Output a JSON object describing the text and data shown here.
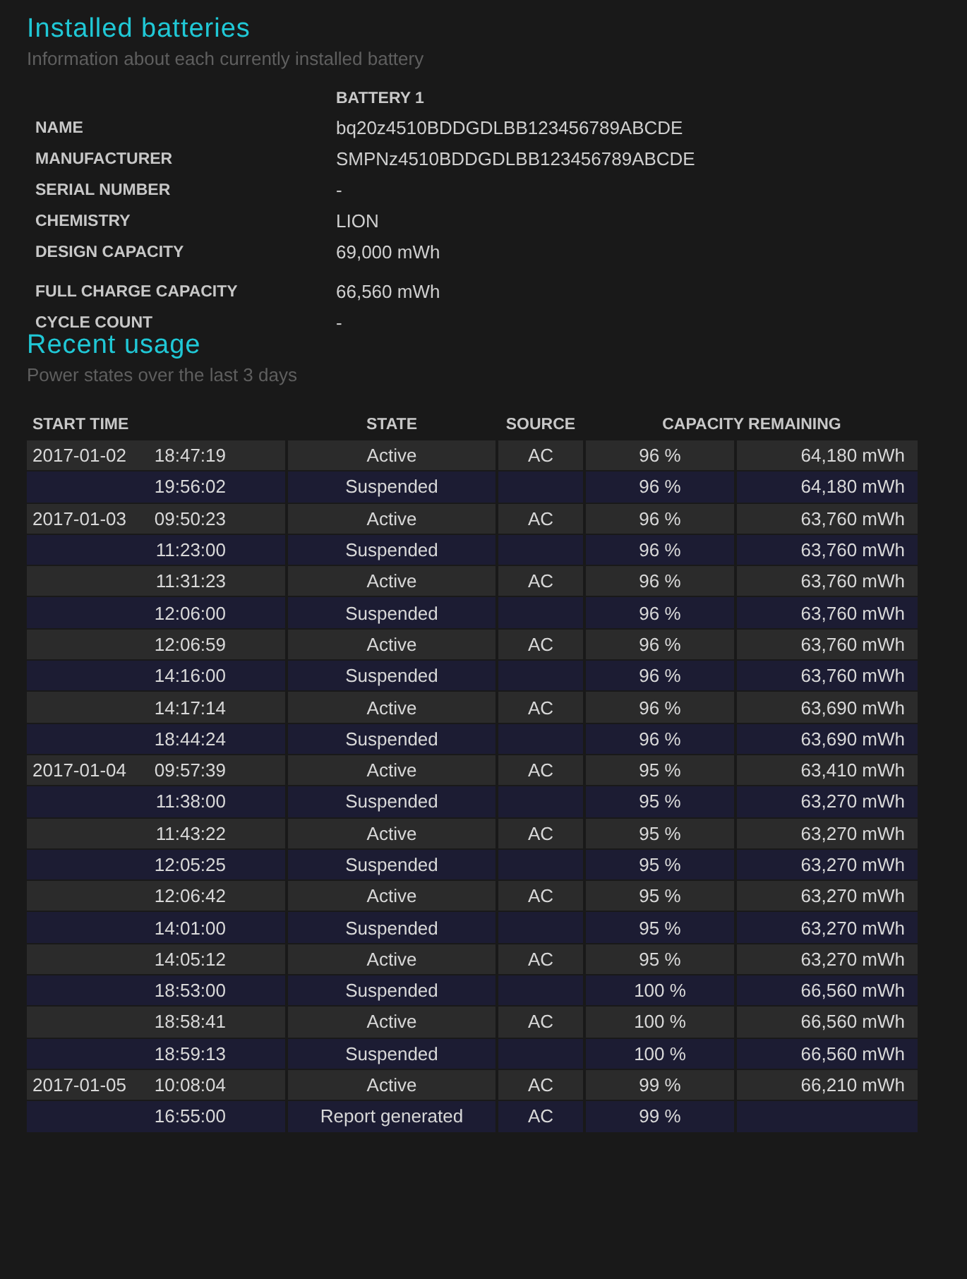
{
  "installed": {
    "title": "Installed batteries",
    "subtitle": "Information about each currently installed battery",
    "column": "BATTERY 1",
    "fields": [
      {
        "label": "NAME",
        "value": "bq20z4510BDDGDLBB123456789ABCDE"
      },
      {
        "label": "MANUFACTURER",
        "value": "SMPNz4510BDDGDLBB123456789ABCDE"
      },
      {
        "label": "SERIAL NUMBER",
        "value": "-"
      },
      {
        "label": "CHEMISTRY",
        "value": "LION"
      },
      {
        "label": "DESIGN CAPACITY",
        "value": "69,000 mWh"
      },
      {
        "label": "FULL CHARGE CAPACITY",
        "value": "66,560 mWh"
      },
      {
        "label": "CYCLE COUNT",
        "value": "-"
      }
    ]
  },
  "recent": {
    "title": "Recent usage",
    "subtitle": "Power states over the last 3 days",
    "columns": [
      "START TIME",
      "STATE",
      "SOURCE",
      "CAPACITY REMAINING"
    ],
    "rows": [
      {
        "date": "2017-01-02",
        "time": "18:47:19",
        "state": "Active",
        "source": "AC",
        "percent": "96 %",
        "capacity": "64,180 mWh"
      },
      {
        "time": "19:56:02",
        "state": "Suspended",
        "percent": "96 %",
        "capacity": "64,180 mWh"
      },
      {
        "date": "2017-01-03",
        "time": "09:50:23",
        "state": "Active",
        "source": "AC",
        "percent": "96 %",
        "capacity": "63,760 mWh"
      },
      {
        "time": "11:23:00",
        "state": "Suspended",
        "percent": "96 %",
        "capacity": "63,760 mWh"
      },
      {
        "time": "11:31:23",
        "state": "Active",
        "source": "AC",
        "percent": "96 %",
        "capacity": "63,760 mWh"
      },
      {
        "time": "12:06:00",
        "state": "Suspended",
        "percent": "96 %",
        "capacity": "63,760 mWh"
      },
      {
        "time": "12:06:59",
        "state": "Active",
        "source": "AC",
        "percent": "96 %",
        "capacity": "63,760 mWh"
      },
      {
        "time": "14:16:00",
        "state": "Suspended",
        "percent": "96 %",
        "capacity": "63,760 mWh"
      },
      {
        "time": "14:17:14",
        "state": "Active",
        "source": "AC",
        "percent": "96 %",
        "capacity": "63,690 mWh"
      },
      {
        "time": "18:44:24",
        "state": "Suspended",
        "percent": "96 %",
        "capacity": "63,690 mWh"
      },
      {
        "date": "2017-01-04",
        "time": "09:57:39",
        "state": "Active",
        "source": "AC",
        "percent": "95 %",
        "capacity": "63,410 mWh"
      },
      {
        "time": "11:38:00",
        "state": "Suspended",
        "percent": "95 %",
        "capacity": "63,270 mWh"
      },
      {
        "time": "11:43:22",
        "state": "Active",
        "source": "AC",
        "percent": "95 %",
        "capacity": "63,270 mWh"
      },
      {
        "time": "12:05:25",
        "state": "Suspended",
        "percent": "95 %",
        "capacity": "63,270 mWh"
      },
      {
        "time": "12:06:42",
        "state": "Active",
        "source": "AC",
        "percent": "95 %",
        "capacity": "63,270 mWh"
      },
      {
        "time": "14:01:00",
        "state": "Suspended",
        "percent": "95 %",
        "capacity": "63,270 mWh"
      },
      {
        "time": "14:05:12",
        "state": "Active",
        "source": "AC",
        "percent": "95 %",
        "capacity": "63,270 mWh"
      },
      {
        "time": "18:53:00",
        "state": "Suspended",
        "percent": "100 %",
        "capacity": "66,560 mWh"
      },
      {
        "time": "18:58:41",
        "state": "Active",
        "source": "AC",
        "percent": "100 %",
        "capacity": "66,560 mWh"
      },
      {
        "time": "18:59:13",
        "state": "Suspended",
        "percent": "100 %",
        "capacity": "66,560 mWh"
      },
      {
        "date": "2017-01-05",
        "time": "10:08:04",
        "state": "Active",
        "source": "AC",
        "percent": "99 %",
        "capacity": "66,210 mWh"
      },
      {
        "time": "16:55:00",
        "state": "Report generated",
        "source": "AC",
        "percent": "99 %"
      }
    ]
  }
}
